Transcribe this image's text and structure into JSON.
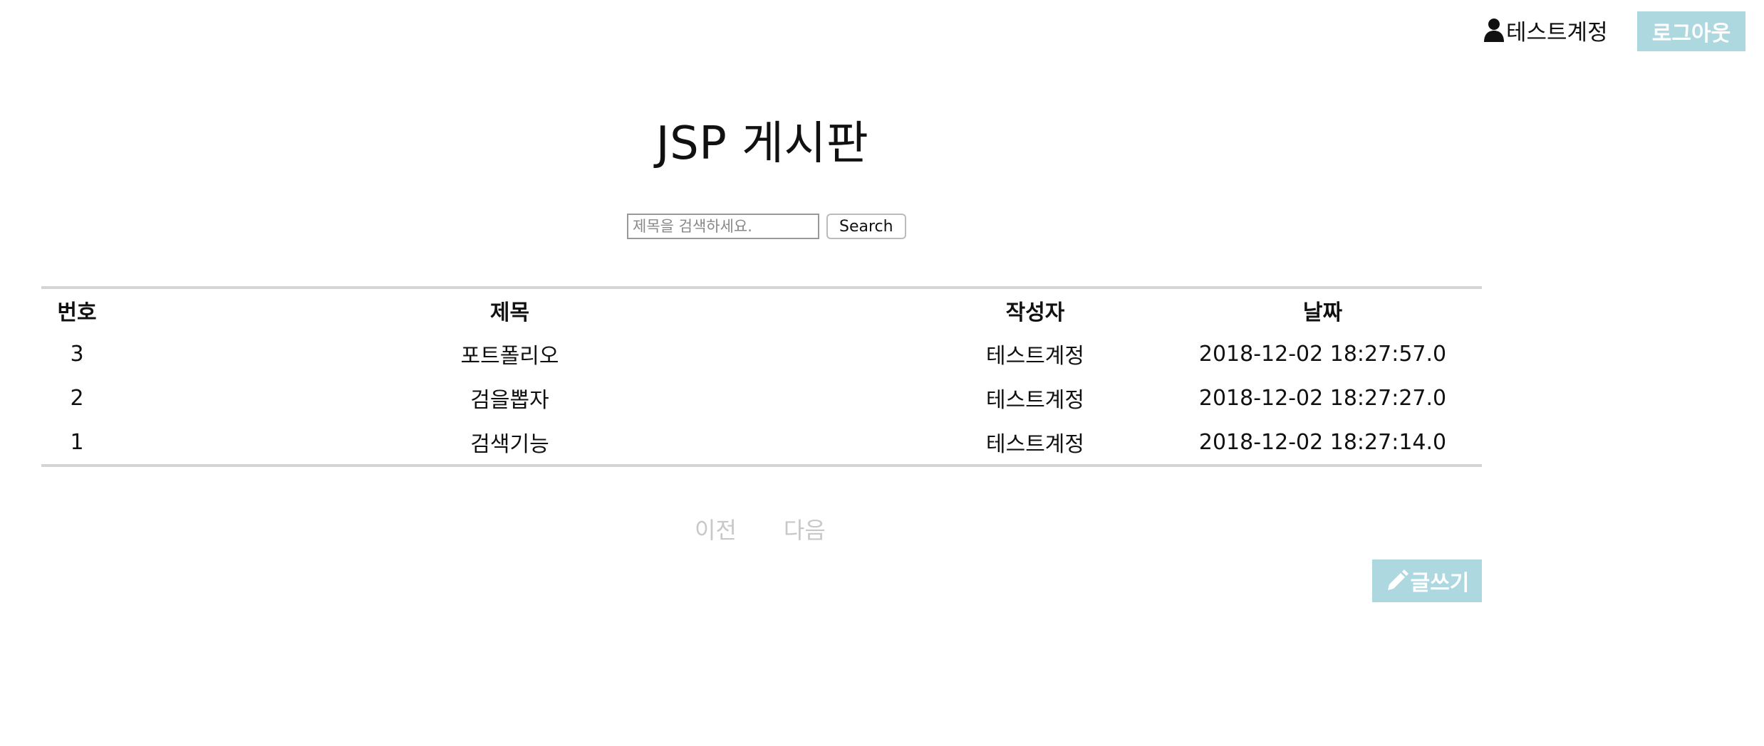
{
  "header": {
    "username": "테스트계정",
    "logout_label": "로그아웃",
    "user_icon": "user-icon"
  },
  "title": "JSP 게시판",
  "search": {
    "placeholder": "제목을 검색하세요.",
    "value": "",
    "button_label": "Search"
  },
  "table": {
    "columns": [
      "번호",
      "제목",
      "작성자",
      "날짜"
    ],
    "rows": [
      {
        "no": "3",
        "title": "포트폴리오",
        "author": "테스트계정",
        "date": "2018-12-02 18:27:57.0"
      },
      {
        "no": "2",
        "title": "검을뽑자",
        "author": "테스트계정",
        "date": "2018-12-02 18:27:27.0"
      },
      {
        "no": "1",
        "title": "검색기능",
        "author": "테스트계정",
        "date": "2018-12-02 18:27:14.0"
      }
    ]
  },
  "pagination": {
    "prev_label": "이전",
    "next_label": "다음"
  },
  "write_button": {
    "label": "글쓰기",
    "icon": "pencil-icon"
  },
  "colors": {
    "accent": "#add8e0",
    "pager_disabled": "#c8c8c8",
    "table_border": "#d4d4d4"
  }
}
